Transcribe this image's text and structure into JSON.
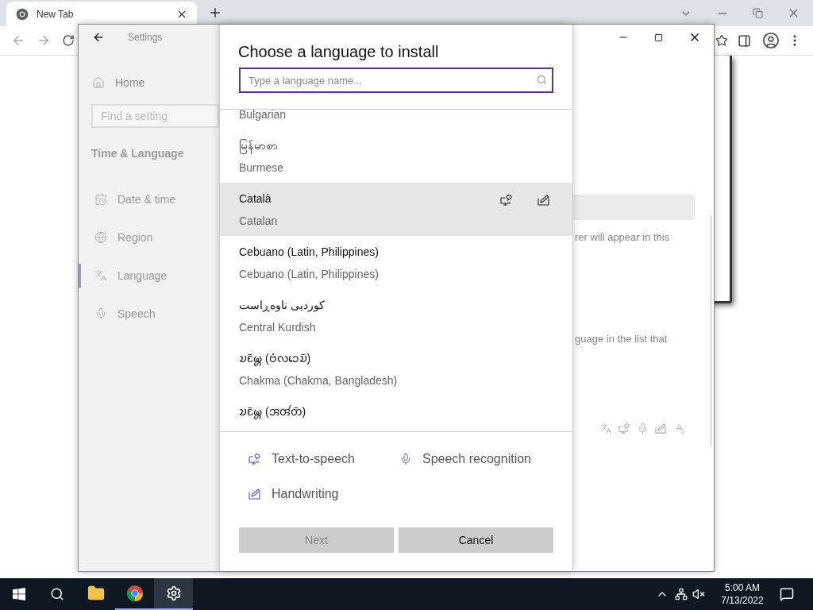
{
  "browser": {
    "tab_title": "New Tab"
  },
  "settings": {
    "title": "Settings",
    "home": "Home",
    "search_placeholder": "Find a setting",
    "section": "Time & Language",
    "nav": [
      {
        "label": "Date & time",
        "selected": false
      },
      {
        "label": "Region",
        "selected": false
      },
      {
        "label": "Language",
        "selected": true
      },
      {
        "label": "Speech",
        "selected": false
      }
    ],
    "right_lines": [
      "rer will appear in this",
      "guage in the list that"
    ]
  },
  "dialog": {
    "title": "Choose a language to install",
    "search": {
      "placeholder": "Type a language name..."
    },
    "languages": [
      {
        "english": "Bulgarian",
        "selected": false
      },
      {
        "native": "မြန်မာစာ",
        "english": "Burmese",
        "selected": false
      },
      {
        "native": "Català",
        "english": "Catalan",
        "selected": true,
        "text_to_speech": true,
        "handwriting": true
      },
      {
        "native": "Cebuano (Latin, Philippines)",
        "english": "Cebuano (Latin, Philippines)",
        "selected": false
      },
      {
        "native": "کوردیی ناوەڕاست",
        "english": "Central Kurdish",
        "selected": false
      },
      {
        "native": "𑄌𑄋𑄴𑄟𑄳𑄦 (𑄝𑄁𑄣𑄘𑄬𑄌𑄴)",
        "english": "Chakma (Chakma, Bangladesh)",
        "selected": false
      },
      {
        "native": "𑄌𑄋𑄴𑄟𑄳𑄦 (𑄞𑄢𑄧𑄖𑄴)",
        "selected": false
      }
    ],
    "legend": [
      {
        "kind": "tts",
        "label": "Text-to-speech"
      },
      {
        "kind": "speech",
        "label": "Speech recognition"
      },
      {
        "kind": "handwriting",
        "label": "Handwriting"
      }
    ],
    "buttons": [
      {
        "label": "Next",
        "disabled": true
      },
      {
        "label": "Cancel",
        "disabled": false
      }
    ]
  },
  "taskbar": {
    "apps": [
      {
        "kind": "explorer",
        "running": false,
        "active": false
      },
      {
        "kind": "chrome",
        "running": true,
        "active": false
      },
      {
        "kind": "settings",
        "running": true,
        "active": true
      }
    ],
    "time": "5:00 AM",
    "date": "7/13/2022"
  }
}
